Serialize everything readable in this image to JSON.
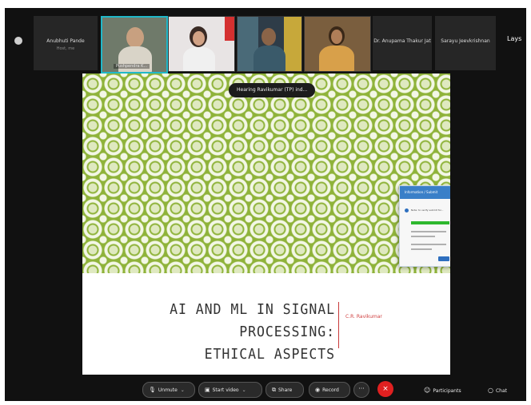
{
  "meeting": {
    "participants_strip": [
      {
        "type": "name",
        "name": "Anubhuti Pande",
        "sub": "Host, me"
      },
      {
        "type": "video",
        "label": "Pushpendra K..."
      },
      {
        "type": "video",
        "label": ""
      },
      {
        "type": "video",
        "label": ""
      },
      {
        "type": "video",
        "label": ""
      },
      {
        "type": "name",
        "name": "Dr. Anupama Thakur Jat",
        "sub": ""
      },
      {
        "type": "name",
        "name": "Sarayu Jeevkrishnan",
        "sub": ""
      }
    ],
    "layout_label": "Lays"
  },
  "slide": {
    "speaking_indicator": "Hearing Ravikumar (TP) ind...",
    "title_line1": "AI AND ML IN SIGNAL PROCESSING:",
    "title_line2": "ETHICAL ASPECTS",
    "author": "C.R. Ravikumar",
    "dialog": {
      "header": "Information / Submit",
      "message": "Note: to verify submit for..."
    }
  },
  "toolbar": {
    "unmute": "Unmute",
    "start_video": "Start video",
    "share": "Share",
    "record": "Record",
    "more": "···",
    "leave": "×",
    "participants": "Participants",
    "chat": "Chat"
  },
  "colors": {
    "pattern_green": "#8fb33a",
    "leave_red": "#e02020",
    "author_red": "#d04040",
    "active_tile": "#20b8c8"
  }
}
